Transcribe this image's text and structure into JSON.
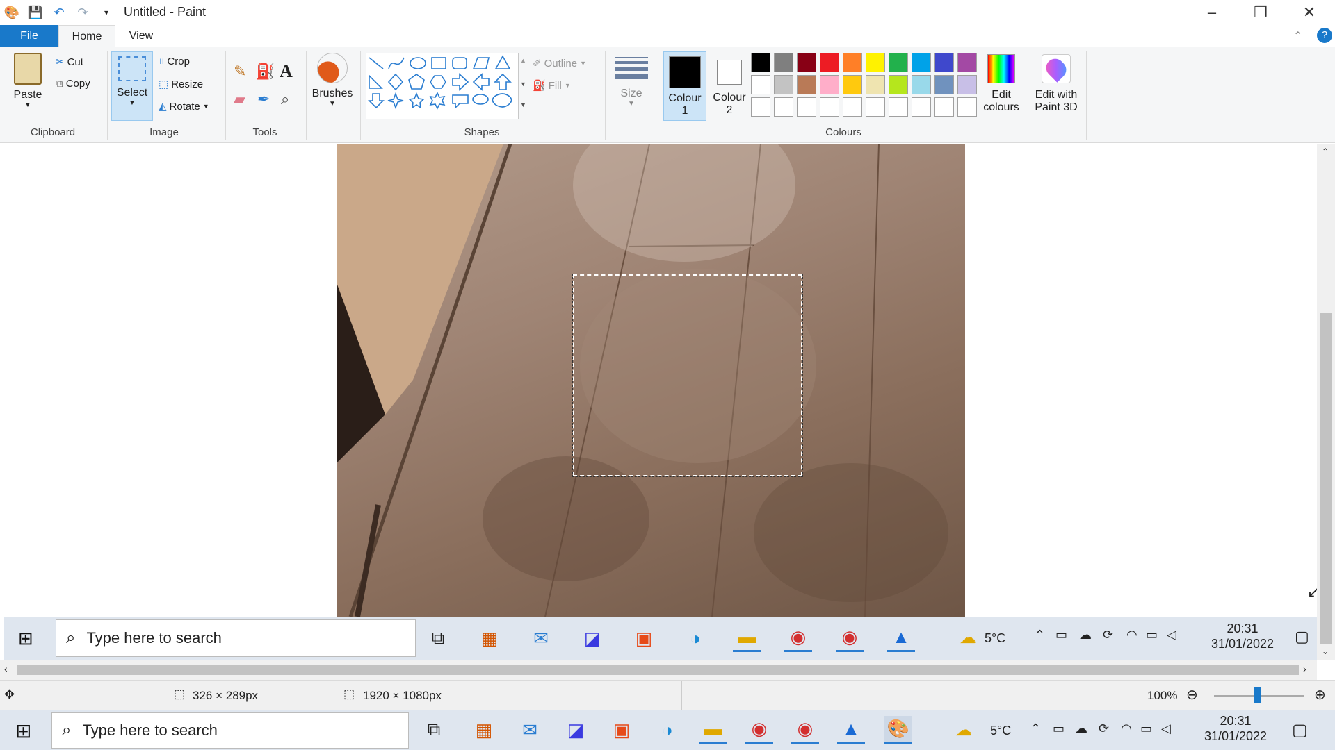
{
  "window": {
    "title": "Untitled - Paint"
  },
  "tabs": [
    {
      "label": "File"
    },
    {
      "label": "Home"
    },
    {
      "label": "View"
    }
  ],
  "ribbon": {
    "clipboard": {
      "paste": "Paste",
      "cut": "Cut",
      "copy": "Copy",
      "group": "Clipboard"
    },
    "image": {
      "select": "Select",
      "crop": "Crop",
      "resize": "Resize",
      "rotate": "Rotate",
      "group": "Image"
    },
    "tools": {
      "group": "Tools"
    },
    "brushes": {
      "label": "Brushes"
    },
    "shapes": {
      "outline": "Outline",
      "fill": "Fill",
      "group": "Shapes"
    },
    "size": {
      "label": "Size"
    },
    "colours": {
      "colour1_line1": "Colour",
      "colour1_line2": "1",
      "colour2_line1": "Colour",
      "colour2_line2": "2",
      "edit_line1": "Edit",
      "edit_line2": "colours",
      "group": "Colours",
      "palette_row1": [
        "#000000",
        "#7f7f7f",
        "#880015",
        "#ed1c24",
        "#ff7f27",
        "#fff200",
        "#22b14c",
        "#00a2e8",
        "#3f48cc",
        "#a349a4"
      ],
      "palette_row2": [
        "#ffffff",
        "#c3c3c3",
        "#b97a57",
        "#ffaec9",
        "#ffc90e",
        "#efe4b0",
        "#b5e61d",
        "#99d9ea",
        "#7092be",
        "#c8bfe7"
      ],
      "primary": "#000000",
      "secondary": "#ffffff"
    },
    "paint3d": {
      "line1": "Edit with",
      "line2": "Paint 3D"
    }
  },
  "status": {
    "selection_size": "326 × 289px",
    "image_size": "1920 × 1080px",
    "zoom": "100%"
  },
  "inner_taskbar": {
    "search_placeholder": "Type here to search",
    "weather": "5°C",
    "time": "20:31",
    "date": "31/01/2022"
  },
  "taskbar": {
    "search_placeholder": "Type here to search",
    "weather": "5°C",
    "time": "20:31",
    "date": "31/01/2022"
  }
}
